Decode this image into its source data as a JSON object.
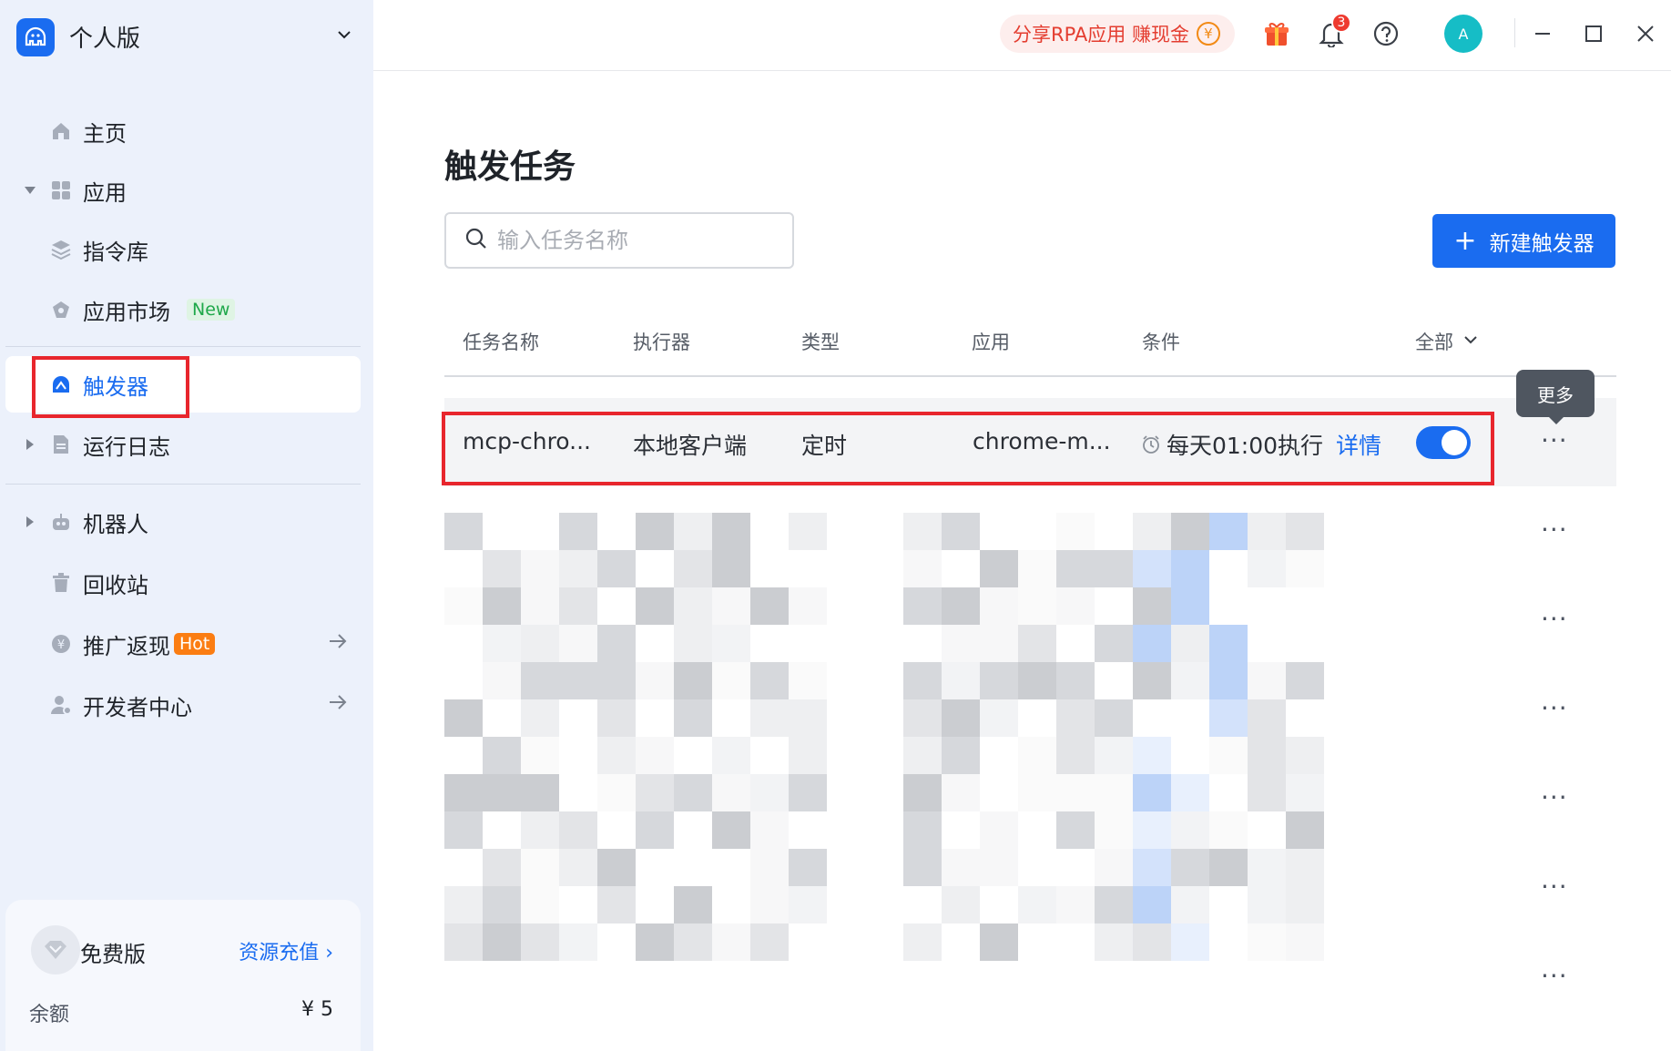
{
  "brand": {
    "name": "个人版"
  },
  "sidebar": {
    "items": [
      {
        "label": "主页",
        "icon": "home-icon"
      },
      {
        "label": "应用",
        "icon": "apps-grid-icon"
      },
      {
        "label": "指令库",
        "icon": "layers-icon"
      },
      {
        "label": "应用市场",
        "icon": "market-icon",
        "badge": "New"
      },
      {
        "label": "触发器",
        "icon": "trigger-icon",
        "active": true
      },
      {
        "label": "运行日志",
        "icon": "log-icon"
      },
      {
        "label": "机器人",
        "icon": "robot-icon"
      },
      {
        "label": "回收站",
        "icon": "trash-icon"
      },
      {
        "label": "推广返现",
        "icon": "coin-icon",
        "badge": "Hot"
      },
      {
        "label": "开发者中心",
        "icon": "developer-icon"
      }
    ]
  },
  "plan": {
    "name": "免费版",
    "link": "资源充值 ›",
    "balance_label": "余额",
    "balance_value": "¥ 5"
  },
  "topbar": {
    "promo": "分享RPA应用 赚现金",
    "promo_coin": "¥",
    "notif_count": "3",
    "avatar": "A"
  },
  "page": {
    "title": "触发任务"
  },
  "search": {
    "placeholder": "输入任务名称",
    "value": ""
  },
  "new_button": {
    "label": "新建触发器"
  },
  "table": {
    "headers": [
      "任务名称",
      "执行器",
      "类型",
      "应用",
      "条件",
      "全部"
    ],
    "row": {
      "name": "mcp-chro...",
      "executor": "本地客户端",
      "type": "定时",
      "app": "chrome-m...",
      "condition": "每天01:00执行",
      "detail_link": "详情",
      "enabled": true
    },
    "more": "···",
    "tooltip": "更多"
  },
  "colors": {
    "accent": "#1a6cf0",
    "highlight_box": "#e8262d",
    "sidebar_bg": "#ecf1fb"
  }
}
